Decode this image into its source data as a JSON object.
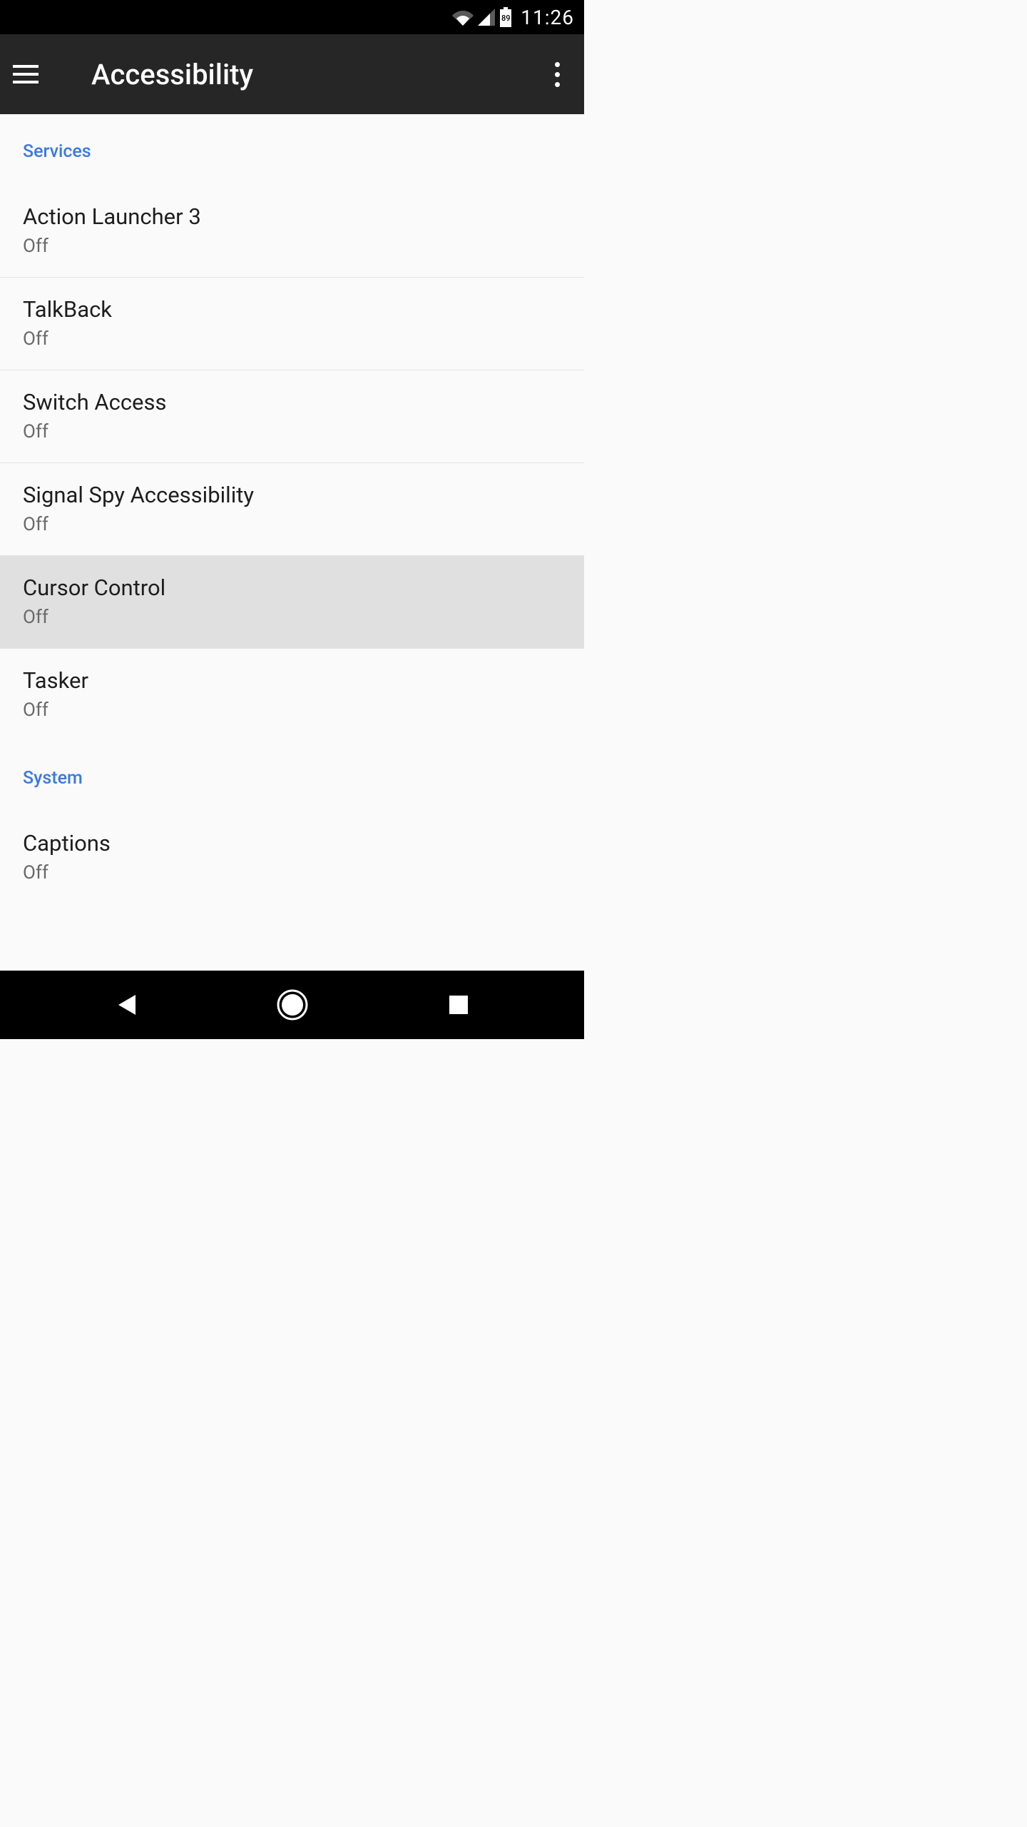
{
  "status": {
    "time": "11:26",
    "battery_level": "89"
  },
  "appbar": {
    "title": "Accessibility"
  },
  "sections": [
    {
      "header": "Services",
      "items": [
        {
          "title": "Action Launcher 3",
          "status": "Off",
          "highlighted": false,
          "border": true
        },
        {
          "title": "TalkBack",
          "status": "Off",
          "highlighted": false,
          "border": true
        },
        {
          "title": "Switch Access",
          "status": "Off",
          "highlighted": false,
          "border": true
        },
        {
          "title": "Signal Spy Accessibility",
          "status": "Off",
          "highlighted": false,
          "border": true
        },
        {
          "title": "Cursor Control",
          "status": "Off",
          "highlighted": true,
          "border": true
        },
        {
          "title": "Tasker",
          "status": "Off",
          "highlighted": false,
          "border": false
        }
      ]
    },
    {
      "header": "System",
      "items": [
        {
          "title": "Captions",
          "status": "Off",
          "highlighted": false,
          "border": false
        }
      ]
    }
  ]
}
